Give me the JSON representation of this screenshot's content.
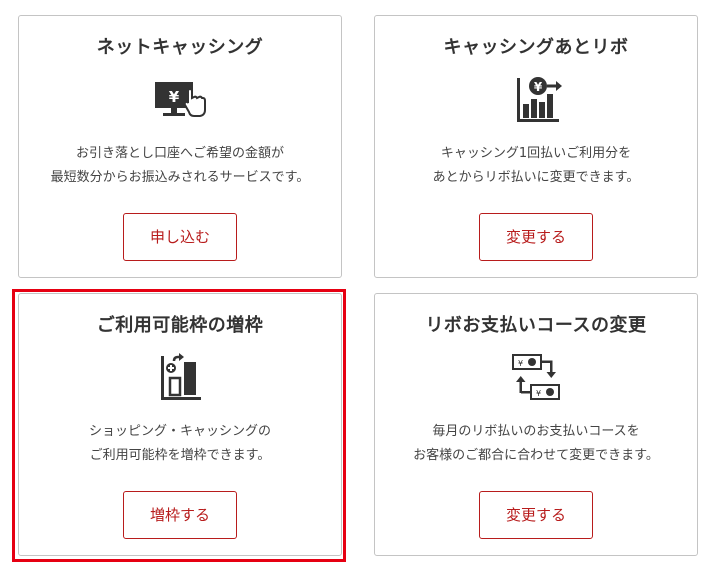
{
  "cards": [
    {
      "title": "ネットキャッシング",
      "icon": "monitor-yen-icon",
      "desc": [
        "お引き落とし口座へご希望の金額が",
        "最短数分からお振込みされるサービスです。"
      ],
      "button": "申し込む"
    },
    {
      "title": "キャッシングあとリボ",
      "icon": "bar-chart-yen-icon",
      "desc": [
        "キャッシング1回払いご利用分を",
        "あとからリボ払いに変更できます。"
      ],
      "button": "変更する"
    },
    {
      "title": "ご利用可能枠の増枠",
      "icon": "limit-increase-icon",
      "desc": [
        "ショッピング・キャッシングの",
        "ご利用可能枠を増枠できます。"
      ],
      "button": "増枠する"
    },
    {
      "title": "リボお支払いコースの変更",
      "icon": "exchange-bills-icon",
      "desc": [
        "毎月のリボ払いのお支払いコースを",
        "お客様のご都合に合わせて変更できます。"
      ],
      "button": "変更する"
    }
  ],
  "colors": {
    "accent": "#b81c1c",
    "highlight": "#e60012",
    "icon": "#333333",
    "border": "#c4c4c4"
  },
  "icon_glyphs": {
    "yen": "¥"
  }
}
